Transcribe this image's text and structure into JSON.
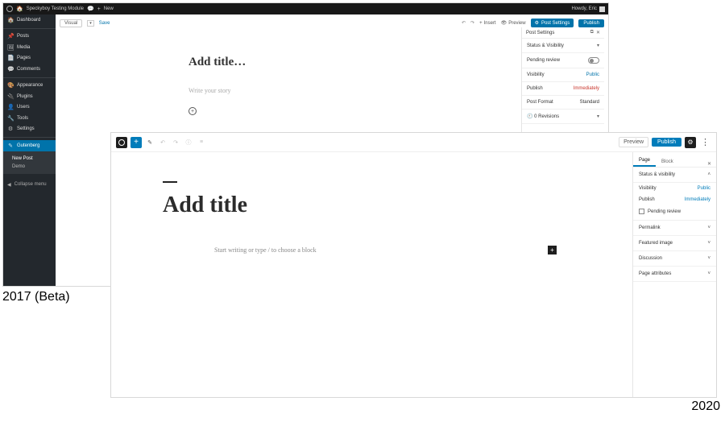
{
  "captions": {
    "beta": "2017 (Beta)",
    "current": "2020"
  },
  "w17": {
    "adminbar": {
      "site": "Speckyboy Testing Module",
      "comments_icon": "💬",
      "add_new_plus": "+",
      "add_new": "New",
      "home_icon": "🏠",
      "howdy": "Howdy, Eric"
    },
    "sidebar": {
      "items": [
        {
          "icon": "🏠",
          "label": "Dashboard"
        },
        {
          "icon": "📌",
          "label": "Posts"
        },
        {
          "icon": "🖼",
          "label": "Media"
        },
        {
          "icon": "📄",
          "label": "Pages"
        },
        {
          "icon": "💬",
          "label": "Comments"
        }
      ],
      "items2": [
        {
          "icon": "🎨",
          "label": "Appearance"
        },
        {
          "icon": "🔌",
          "label": "Plugins"
        },
        {
          "icon": "👤",
          "label": "Users"
        },
        {
          "icon": "🔧",
          "label": "Tools"
        },
        {
          "icon": "⚙",
          "label": "Settings"
        }
      ],
      "active": {
        "icon": "✎",
        "label": "Gutenberg"
      },
      "sub": [
        "New Post",
        "Demo"
      ],
      "collapse_icon": "◀",
      "collapse": "Collapse menu"
    },
    "toolbar": {
      "mode": "Visual",
      "save": "Save",
      "insert": "Insert",
      "preview": "Preview",
      "settings": "Post Settings",
      "publish": "Publish",
      "undo": "↶",
      "redo": "↷",
      "plus": "+",
      "eye": "👁",
      "gear": "⚙",
      "caret": "▾"
    },
    "editor": {
      "title_placeholder": "Add title…",
      "story_placeholder": "Write your story",
      "plus": "+"
    },
    "panel": {
      "header": "Post Settings",
      "popout": "⧉",
      "close": "✕",
      "status": "Status & Visibility",
      "pending": "Pending review",
      "visibility_label": "Visibility",
      "visibility_value": "Public",
      "publish_label": "Publish",
      "publish_value": "Immediately",
      "format_label": "Post Format",
      "format_value": "Standard",
      "revisions_icon": "🕘",
      "revisions": "0 Revisions",
      "caret": "▾"
    }
  },
  "w20": {
    "toolbar": {
      "add": "+",
      "edit": "✎",
      "undo": "↶",
      "redo": "↷",
      "info": "ⓘ",
      "outline": "≡",
      "preview": "Preview",
      "publish": "Publish",
      "gear": "⚙",
      "more": "⋮"
    },
    "editor": {
      "title_placeholder": "Add title",
      "block_prompt": "Start writing or type / to choose a block",
      "add": "+"
    },
    "panel": {
      "tabs": [
        "Page",
        "Block"
      ],
      "close": "✕",
      "status": "Status & visibility",
      "caret_up": "˄",
      "caret_down": "˅",
      "visibility_label": "Visibility",
      "visibility_value": "Public",
      "publish_label": "Publish",
      "publish_value": "Immediately",
      "pending": "Pending review",
      "sections": [
        "Permalink",
        "Featured image",
        "Discussion",
        "Page attributes"
      ]
    }
  }
}
